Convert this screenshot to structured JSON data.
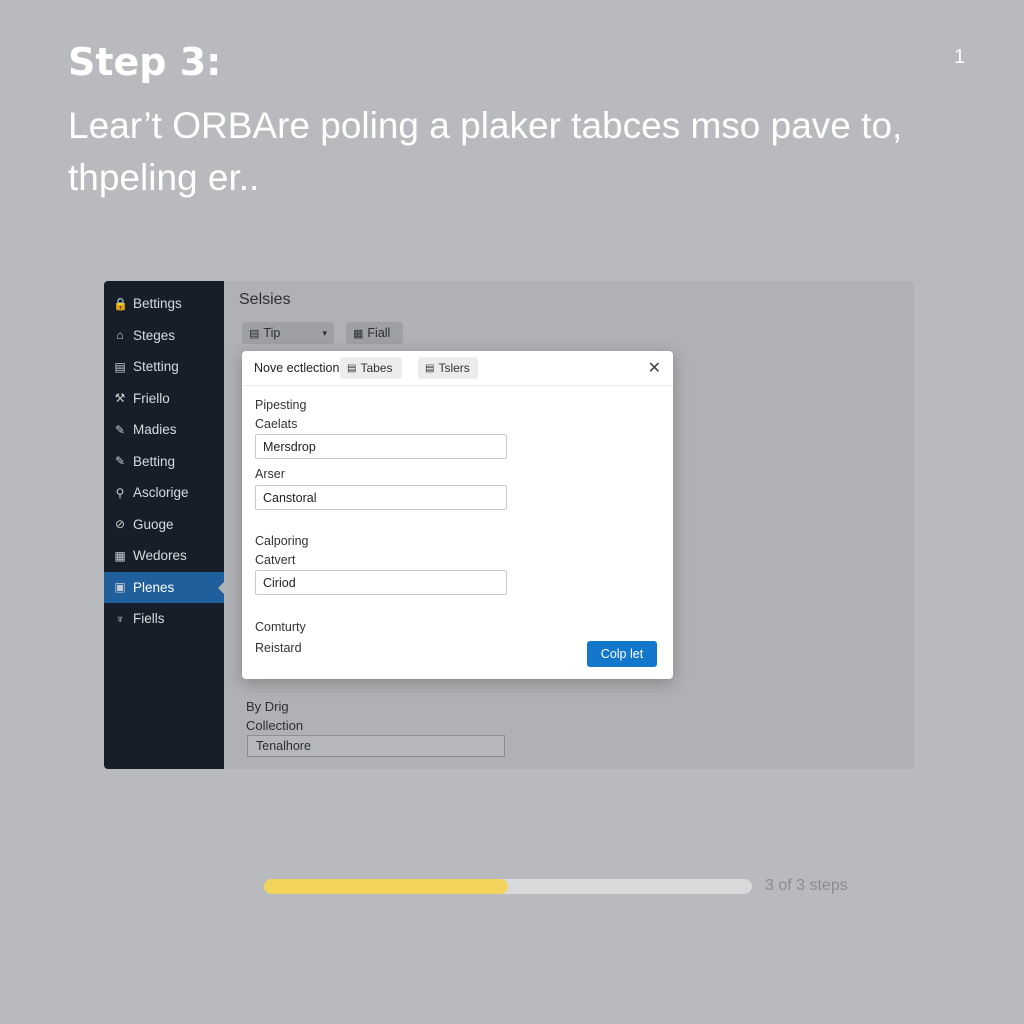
{
  "header": {
    "step_title": "Step 3:",
    "page_number": "1",
    "subtitle": "Lear’t ORBAre poling a plaker tabces mso pave to, thpeling er.."
  },
  "sidebar": {
    "items": [
      {
        "icon": "lock-icon",
        "glyph": "🔒",
        "label": "Bettings"
      },
      {
        "icon": "home-icon",
        "glyph": "⌂",
        "label": "Steges"
      },
      {
        "icon": "layout-icon",
        "glyph": "▤",
        "label": "Stetting"
      },
      {
        "icon": "tool-icon",
        "glyph": "⚒",
        "label": "Friello"
      },
      {
        "icon": "pencil-icon",
        "glyph": "✎",
        "label": "Madies"
      },
      {
        "icon": "pencil-icon",
        "glyph": "✎",
        "label": "Betting"
      },
      {
        "icon": "search-icon",
        "glyph": "⚲",
        "label": "Asclorige"
      },
      {
        "icon": "link-icon",
        "glyph": "⊘",
        "label": "Guoge"
      },
      {
        "icon": "calendar-icon",
        "glyph": "▦",
        "label": "Wedores"
      },
      {
        "icon": "document-icon",
        "glyph": "▣",
        "label": "Plenes",
        "active": true
      },
      {
        "icon": "mic-icon",
        "glyph": "♆",
        "label": "Fiells"
      }
    ]
  },
  "main": {
    "title": "Selsies",
    "toolbar": {
      "tip_label": "Tip",
      "fiall_label": "Fiall"
    },
    "background_form": {
      "label1": "By Drig",
      "label2": "Collection",
      "input_value": "Tenalhore"
    }
  },
  "modal": {
    "title": "Nove ectlection",
    "tabs": [
      "Tabes",
      "Tslers"
    ],
    "close_glyph": "✕",
    "section1": "Pipesting",
    "field1_label": "Caelats",
    "field1_value": "Mersdrop",
    "field2_label": "Arser",
    "field2_value": "Canstoral",
    "section2": "Calporing",
    "field3_label": "Catvert",
    "field3_value": "Ciriod",
    "label4": "Comturty",
    "label5": "Reistard",
    "primary_button": "Colp let"
  },
  "progress": {
    "percent": 50,
    "text": "3 of 3 steps",
    "fill_color": "#f2d35c"
  },
  "colors": {
    "accent": "#1378cc",
    "sidebar_bg": "#161f29",
    "sidebar_active": "#1e5f9c"
  }
}
